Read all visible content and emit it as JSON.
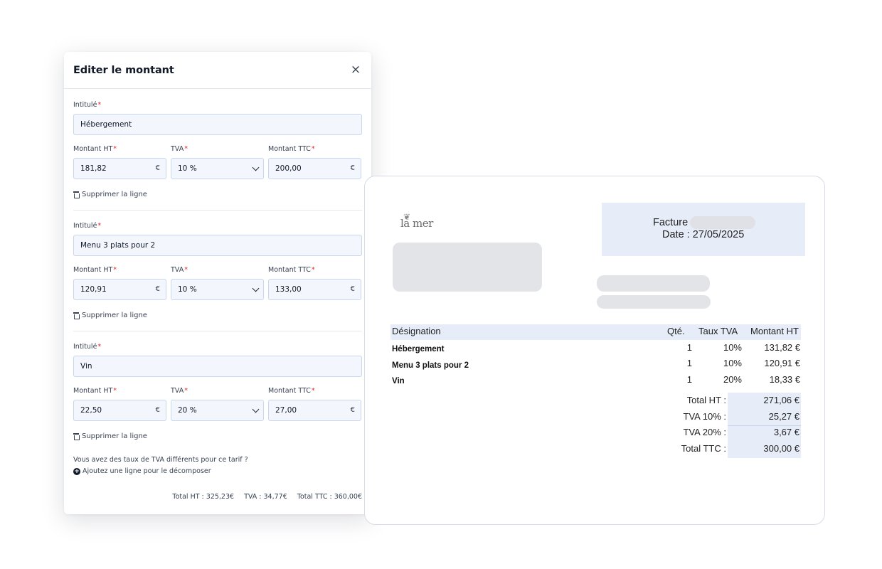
{
  "modal": {
    "title": "Editer le montant",
    "close_symbol": "×",
    "required_mark": "*",
    "labels": {
      "intitule": "Intitulé",
      "montant_ht": "Montant HT",
      "tva": "TVA",
      "montant_ttc": "Montant TTC"
    },
    "currency": "€",
    "delete_label": "Supprimer la ligne",
    "lines": [
      {
        "intitule": "Hébergement",
        "montant_ht": "181,82",
        "tva": "10 %",
        "montant_ttc": "200,00"
      },
      {
        "intitule": "Menu 3 plats pour 2",
        "montant_ht": "120,91",
        "tva": "10 %",
        "montant_ttc": "133,00"
      },
      {
        "intitule": "Vin",
        "montant_ht": "22,50",
        "tva": "20 %",
        "montant_ttc": "27,00"
      }
    ],
    "hint_question": "Vous avez des taux de TVA différents pour ce tarif ?",
    "add_line_label": "Ajoutez une ligne pour le décomposer",
    "totals": {
      "ht": "Total HT : 325,23€",
      "tva": "TVA : 34,77€",
      "ttc": "Total TTC : 360,00€"
    }
  },
  "invoice": {
    "logo_text": "la mer",
    "facture_label": "Facture",
    "date": "Date : 27/05/2025",
    "columns": [
      "Désignation",
      "Qté.",
      "Taux TVA",
      "Montant HT"
    ],
    "rows": [
      {
        "designation": "Hébergement",
        "qte": "1",
        "taux": "10%",
        "montant": "131,82 €"
      },
      {
        "designation": "Menu 3 plats pour 2",
        "qte": "1",
        "taux": "10%",
        "montant": "120,91 €"
      },
      {
        "designation": "Vin",
        "qte": "1",
        "taux": "20%",
        "montant": "18,33 €"
      }
    ],
    "summary": [
      {
        "label": "Total HT :",
        "value": "271,06 €"
      },
      {
        "label": "TVA 10% :",
        "value": "25,27 €"
      },
      {
        "label": "TVA 20% :",
        "value": "3,67 €"
      },
      {
        "label": "Total TTC :",
        "value": "300,00 €"
      }
    ]
  },
  "icons": {
    "close": "close-icon",
    "delete": "trash-icon",
    "add": "plus-circle-icon",
    "select": "chevron-down-icon"
  },
  "colors": {
    "input_bg": "#f3f7fd",
    "input_border": "#c9d7ec",
    "invoice_accent": "#e7edf8",
    "required": "#dc2626"
  }
}
